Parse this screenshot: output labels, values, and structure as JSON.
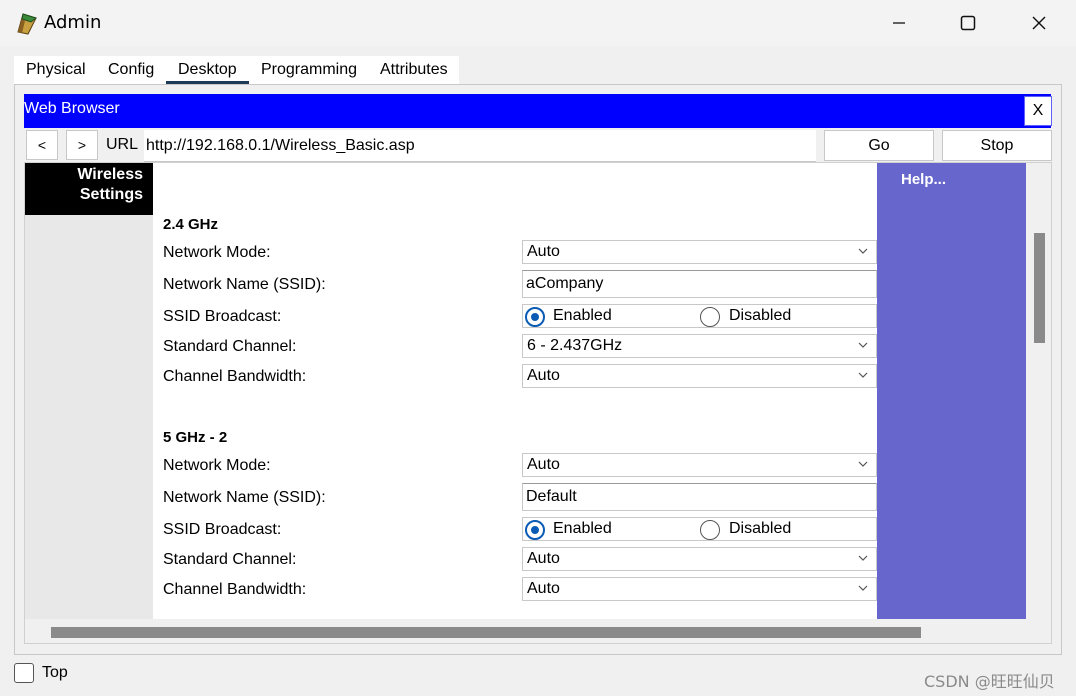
{
  "window": {
    "title": "Admin",
    "minimize_glyph": "—",
    "maximize_glyph": "☐",
    "close_glyph": "✕"
  },
  "tabs": [
    {
      "label": "Physical",
      "active": false
    },
    {
      "label": "Config",
      "active": false
    },
    {
      "label": "Desktop",
      "active": true
    },
    {
      "label": "Programming",
      "active": false
    },
    {
      "label": "Attributes",
      "active": false
    }
  ],
  "browser": {
    "title": "Web Browser",
    "close_label": "X",
    "back_label": "<",
    "forward_label": ">",
    "url_label": "URL",
    "url": "http://192.168.0.1/Wireless_Basic.asp",
    "go_label": "Go",
    "stop_label": "Stop",
    "header_color": "#0000ff"
  },
  "page": {
    "sidebar_title_line1": "Wireless",
    "sidebar_title_line2": "Settings",
    "help_label": "Help...",
    "help_color": "#6666cc",
    "sections": [
      {
        "title": "2.4 GHz",
        "network_mode_label": "Network Mode:",
        "network_mode_value": "Auto",
        "ssid_label": "Network Name (SSID):",
        "ssid_value": "aCompany",
        "broadcast_label": "SSID Broadcast:",
        "enabled_label": "Enabled",
        "disabled_label": "Disabled",
        "broadcast_selected": "Enabled",
        "channel_label": "Standard Channel:",
        "channel_value": "6 - 2.437GHz",
        "bandwidth_label": "Channel Bandwidth:",
        "bandwidth_value": "Auto"
      },
      {
        "title": "5 GHz - 2",
        "network_mode_label": "Network Mode:",
        "network_mode_value": "Auto",
        "ssid_label": "Network Name (SSID):",
        "ssid_value": "Default",
        "broadcast_label": "SSID Broadcast:",
        "enabled_label": "Enabled",
        "disabled_label": "Disabled",
        "broadcast_selected": "Enabled",
        "channel_label": "Standard Channel:",
        "channel_value": "Auto",
        "bandwidth_label": "Channel Bandwidth:",
        "bandwidth_value": "Auto"
      }
    ]
  },
  "footer": {
    "top_label": "Top",
    "top_checked": false,
    "watermark": "CSDN @旺旺仙贝"
  }
}
